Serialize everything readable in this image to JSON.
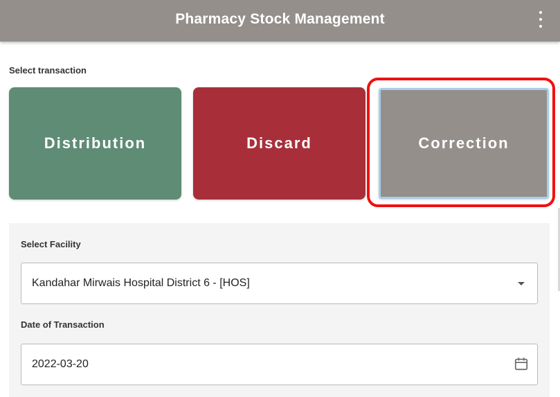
{
  "app_bar": {
    "title": "Pharmacy Stock Management",
    "menu_icon": "more-vertical-icon"
  },
  "transaction": {
    "section_label": "Select transaction",
    "options": [
      {
        "label": "Distribution",
        "color": "#5f8c74"
      },
      {
        "label": "Discard",
        "color": "#a82f3a"
      },
      {
        "label": "Correction",
        "color": "#948f8b",
        "selected": true
      }
    ],
    "highlight_color": "#ee1111"
  },
  "form": {
    "facility": {
      "label": "Select Facility",
      "value": "Kandahar Mirwais Hospital District 6 -  [HOS]",
      "icon": "chevron-down-icon"
    },
    "date": {
      "label": "Date of Transaction",
      "value": "2022-03-20",
      "icon": "calendar-icon"
    }
  }
}
